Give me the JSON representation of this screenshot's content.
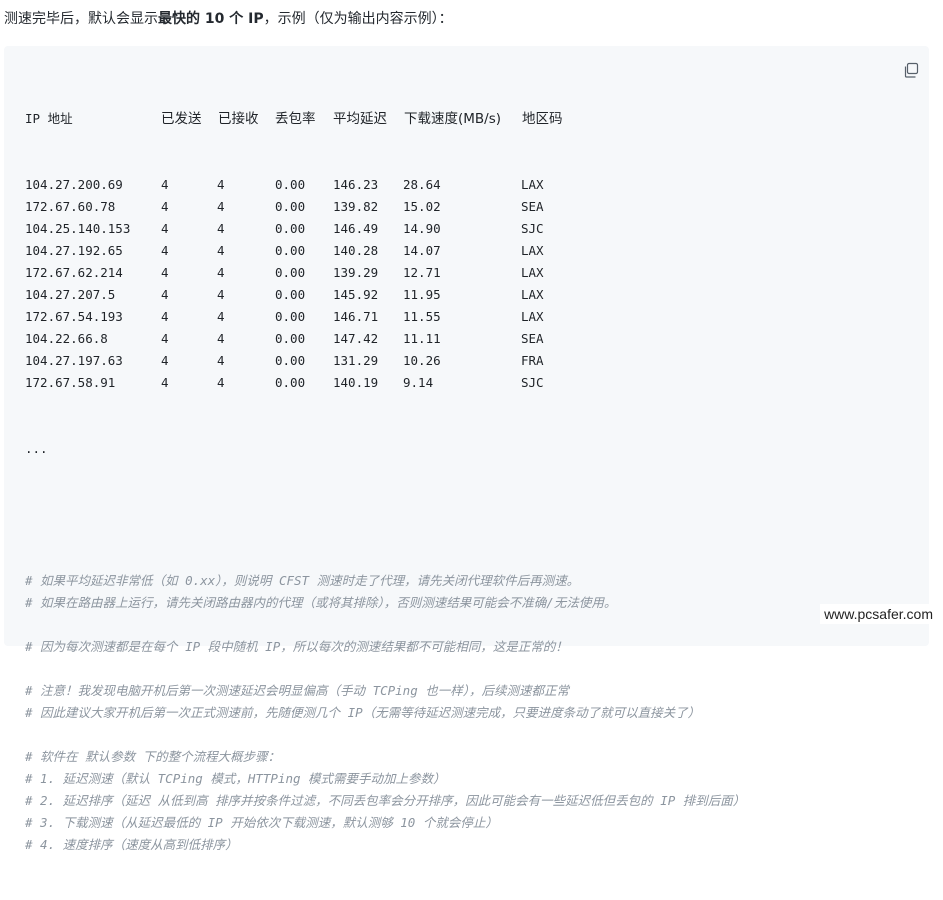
{
  "intro": {
    "prefix": "测速完毕后，默认会显示",
    "bold": "最快的 10 个 IP",
    "suffix": "，示例（仅为输出内容示例）："
  },
  "code": {
    "headers": {
      "ip": "IP 地址",
      "sent": "已发送",
      "received": "已接收",
      "loss": "丢包率",
      "latency": "平均延迟",
      "speed": "下载速度(MB/s)",
      "region": "地区码"
    },
    "rows": [
      {
        "ip": "104.27.200.69",
        "sent": "4",
        "received": "4",
        "loss": "0.00",
        "latency": "146.23",
        "speed": "28.64",
        "region": "LAX"
      },
      {
        "ip": "172.67.60.78",
        "sent": "4",
        "received": "4",
        "loss": "0.00",
        "latency": "139.82",
        "speed": "15.02",
        "region": "SEA"
      },
      {
        "ip": "104.25.140.153",
        "sent": "4",
        "received": "4",
        "loss": "0.00",
        "latency": "146.49",
        "speed": "14.90",
        "region": "SJC"
      },
      {
        "ip": "104.27.192.65",
        "sent": "4",
        "received": "4",
        "loss": "0.00",
        "latency": "140.28",
        "speed": "14.07",
        "region": "LAX"
      },
      {
        "ip": "172.67.62.214",
        "sent": "4",
        "received": "4",
        "loss": "0.00",
        "latency": "139.29",
        "speed": "12.71",
        "region": "LAX"
      },
      {
        "ip": "104.27.207.5",
        "sent": "4",
        "received": "4",
        "loss": "0.00",
        "latency": "145.92",
        "speed": "11.95",
        "region": "LAX"
      },
      {
        "ip": "172.67.54.193",
        "sent": "4",
        "received": "4",
        "loss": "0.00",
        "latency": "146.71",
        "speed": "11.55",
        "region": "LAX"
      },
      {
        "ip": "104.22.66.8",
        "sent": "4",
        "received": "4",
        "loss": "0.00",
        "latency": "147.42",
        "speed": "11.11",
        "region": "SEA"
      },
      {
        "ip": "104.27.197.63",
        "sent": "4",
        "received": "4",
        "loss": "0.00",
        "latency": "131.29",
        "speed": "10.26",
        "region": "FRA"
      },
      {
        "ip": "172.67.58.91",
        "sent": "4",
        "received": "4",
        "loss": "0.00",
        "latency": "140.19",
        "speed": "9.14",
        "region": "SJC"
      }
    ],
    "ellipsis": "...",
    "comments": [
      "# 如果平均延迟非常低（如 0.xx），则说明 CFST 测速时走了代理，请先关闭代理软件后再测速。",
      "# 如果在路由器上运行，请先关闭路由器内的代理（或将其排除），否则测速结果可能会不准确/无法使用。",
      "",
      "# 因为每次测速都是在每个 IP 段中随机 IP，所以每次的测速结果都不可能相同，这是正常的！",
      "",
      "# 注意！我发现电脑开机后第一次测速延迟会明显偏高（手动 TCPing 也一样），后续测速都正常",
      "# 因此建议大家开机后第一次正式测速前，先随便测几个 IP（无需等待延迟测速完成，只要进度条动了就可以直接关了）",
      "",
      "# 软件在 默认参数 下的整个流程大概步骤：",
      "# 1. 延迟测速（默认 TCPing 模式，HTTPing 模式需要手动加上参数）",
      "# 2. 延迟排序（延迟 从低到高 排序并按条件过滤，不同丢包率会分开排序，因此可能会有一些延迟低但丢包的 IP 排到后面）",
      "# 3. 下载测速（从延迟最低的 IP 开始依次下载测速，默认测够 10 个就会停止）",
      "# 4. 速度排序（速度从高到低排序）"
    ]
  },
  "watermark": "www.pcsafer.com"
}
